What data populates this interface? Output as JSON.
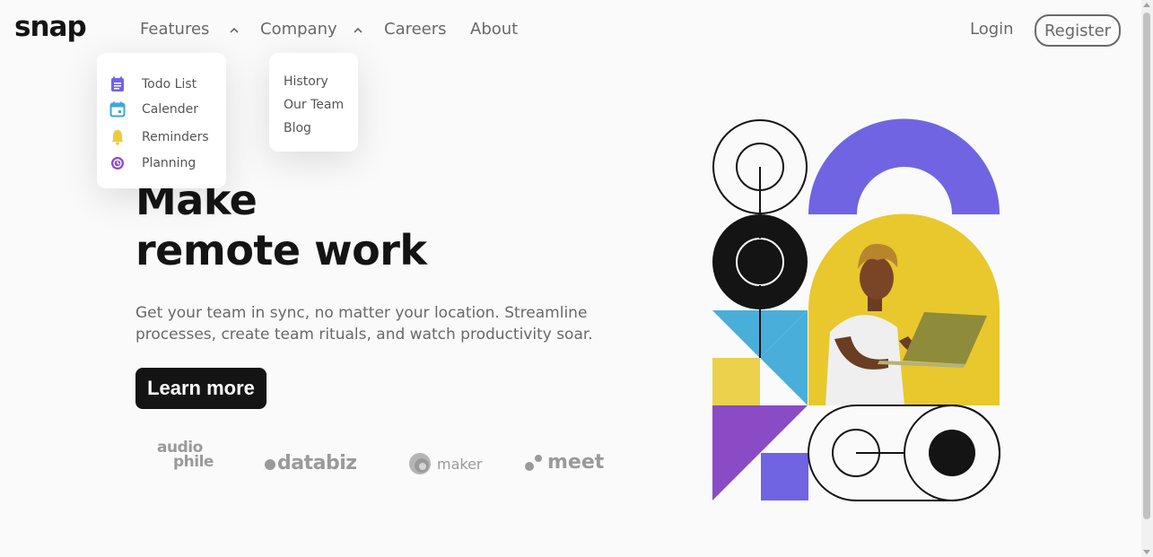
{
  "brand": {
    "logo": "snap"
  },
  "nav": {
    "features_label": "Features",
    "company_label": "Company",
    "careers_label": "Careers",
    "about_label": "About"
  },
  "features_menu": {
    "items": [
      {
        "label": "Todo List",
        "icon": "todo-icon",
        "color": "#7064e3"
      },
      {
        "label": "Calender",
        "icon": "calendar-icon",
        "color": "#3ea6dc"
      },
      {
        "label": "Reminders",
        "icon": "bell-icon",
        "color": "#eccc3c"
      },
      {
        "label": "Planning",
        "icon": "planning-icon",
        "color": "#8d4bcf"
      }
    ]
  },
  "company_menu": {
    "items": [
      {
        "label": "History"
      },
      {
        "label": "Our Team"
      },
      {
        "label": "Blog"
      }
    ]
  },
  "auth": {
    "login_label": "Login",
    "register_label": "Register"
  },
  "hero": {
    "title_line1": "Make",
    "title_line2": "remote work",
    "subtitle": "Get your team in sync, no matter your location. Streamline processes, create team rituals, and watch productivity soar.",
    "cta_label": "Learn more"
  },
  "clients": {
    "audiophile_line1": "audio",
    "audiophile_line2": "phile",
    "databiz": "databiz",
    "maker": "maker",
    "meet": "meet"
  },
  "colors": {
    "purple": "#7064e3",
    "yellow": "#ebd14c",
    "blue": "#4aaedb",
    "violet": "#8a4bc4",
    "dark": "#141414"
  }
}
